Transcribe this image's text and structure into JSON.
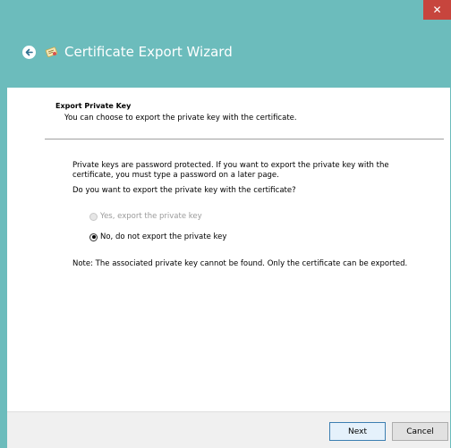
{
  "window": {
    "title": "Certificate Export Wizard",
    "close_glyph": "✕"
  },
  "page": {
    "section_title": "Export Private Key",
    "section_desc": "You can choose to export the private key with the certificate.",
    "para1": "Private keys are password protected. If you want to export the private key with the certificate, you must type a password on a later page.",
    "question": "Do you want to export the private key with the certificate?",
    "options": [
      {
        "label": "Yes, export the private key",
        "enabled": false,
        "selected": false
      },
      {
        "label": "No, do not export the private key",
        "enabled": true,
        "selected": true
      }
    ],
    "note": "Note: The associated private key cannot be found. Only the certificate can be exported."
  },
  "footer": {
    "next_label": "Next",
    "cancel_label": "Cancel"
  },
  "icons": {
    "back": "back-arrow-icon",
    "wizard": "certificate-icon",
    "close": "close-icon"
  },
  "colors": {
    "titlebar_bg": "#6cbcbc",
    "close_bg": "#c7453d",
    "content_bg": "#ffffff",
    "footer_bg": "#f0f0f0"
  }
}
